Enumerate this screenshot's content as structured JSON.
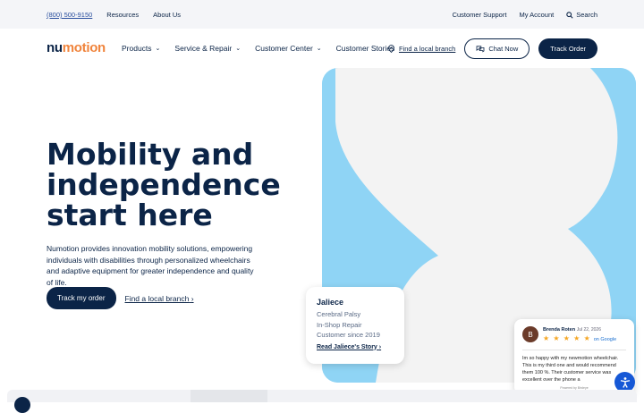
{
  "utility": {
    "phone": "(800) 500-9150",
    "resources": "Resources",
    "about": "About Us",
    "support": "Customer Support",
    "account": "My Account",
    "search": "Search"
  },
  "nav": {
    "logo_nu": "nu",
    "logo_motion": "motion",
    "menu": [
      {
        "label": "Products"
      },
      {
        "label": "Service & Repair"
      },
      {
        "label": "Customer Center"
      },
      {
        "label": "Customer Stories"
      }
    ],
    "find_branch": "Find a local branch",
    "chat": "Chat Now",
    "track": "Track Order"
  },
  "hero": {
    "title_lines": [
      "Mobility and",
      "independence",
      "start here"
    ],
    "description": "Numotion provides innovation mobility solutions, empowering individuals with disabilities through personalized wheelchairs and adaptive equipment for greater independence and quality of life.",
    "primary_button": "Track my order",
    "link": "Find a local branch"
  },
  "story_card": {
    "name": "Jaliece",
    "line1": "Cerebral Palsy",
    "line2": "In-Shop Repair",
    "line3": "Customer since 2019",
    "link": "Read Jaliece's Story"
  },
  "review": {
    "initial": "B",
    "name": "Brenda Roten",
    "date": "Jul 22, 2026",
    "stars": "★ ★ ★ ★ ★",
    "source": "on Google",
    "text": "Im so happy with my newmotion wheelchair. This is my third one and would recommend them 100 %. Their customer service was excellent over the phone a",
    "powered": "Powered by Birdeye"
  },
  "colors": {
    "navy": "#0b2447",
    "accent_orange": "#f0843c",
    "photo_bg": "#8fd4f5",
    "star": "#f5a623",
    "a11y_blue": "#1658d6"
  }
}
